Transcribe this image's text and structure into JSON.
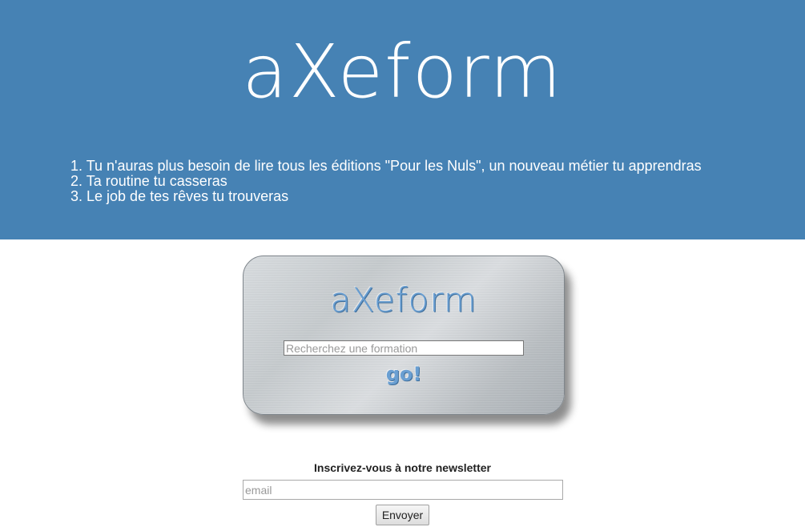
{
  "hero": {
    "logo_text": "aXeform",
    "background_color": "#4682b4",
    "promises": [
      "1. Tu n'auras plus besoin de lire tous les éditions \"Pour les Nuls\", un nouveau métier tu apprendras",
      "2. Ta routine tu casseras",
      "3. Le job de tes rêves tu trouveras"
    ]
  },
  "search_card": {
    "logo_text": "aXeform",
    "search_placeholder": "Recherchez une formation",
    "go_label": "go!",
    "accent_color": "#6a9fd2"
  },
  "newsletter": {
    "title": "Inscrivez-vous à notre newsletter",
    "email_placeholder": "email",
    "submit_label": "Envoyer"
  }
}
